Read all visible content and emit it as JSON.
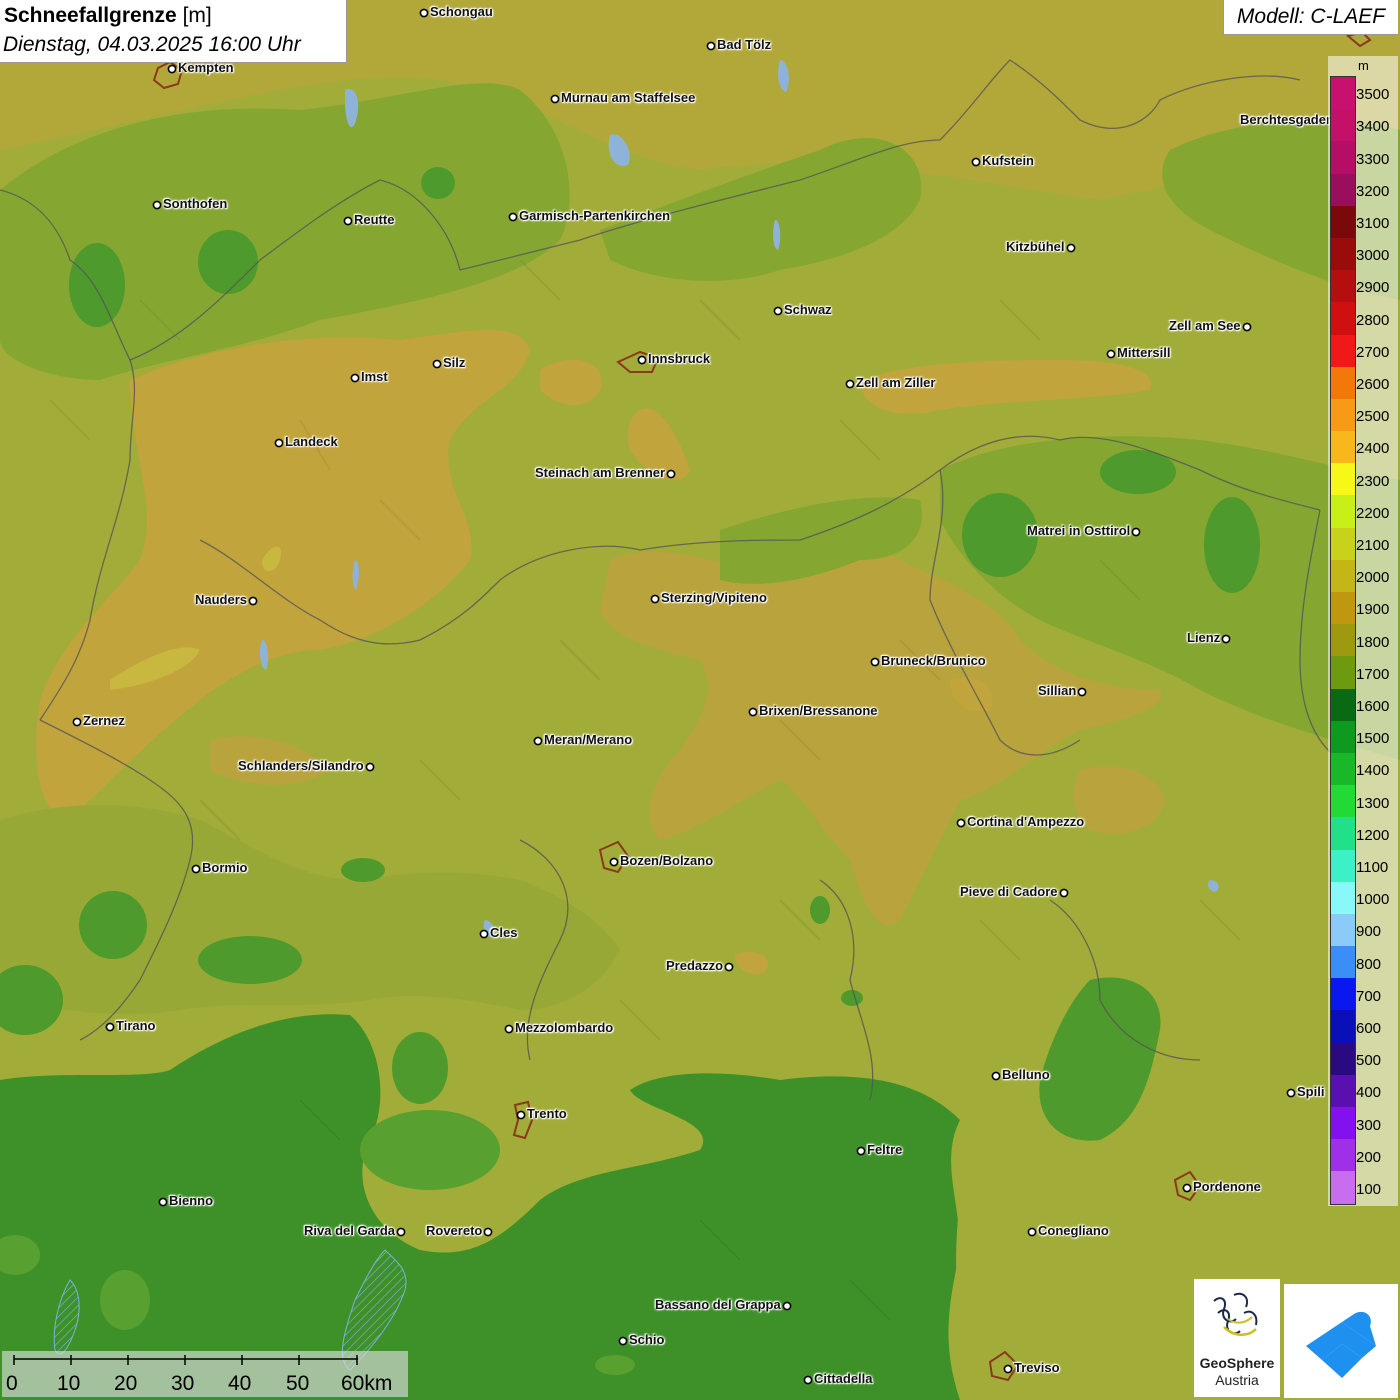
{
  "title": {
    "main": "Schneefallgrenze",
    "unit": "[m]",
    "datetime": "Dienstag, 04.03.2025 16:00 Uhr"
  },
  "model": "Modell: C-LAEF",
  "legend": {
    "unit": "m",
    "levels": [
      {
        "label": "3500",
        "color": "#c8106e"
      },
      {
        "label": "3400",
        "color": "#c5106a"
      },
      {
        "label": "3300",
        "color": "#b50e66"
      },
      {
        "label": "3200",
        "color": "#9a0f5d"
      },
      {
        "label": "3100",
        "color": "#7a0a0a"
      },
      {
        "label": "3000",
        "color": "#9a0b0b"
      },
      {
        "label": "2900",
        "color": "#b50e0e"
      },
      {
        "label": "2800",
        "color": "#d01010"
      },
      {
        "label": "2700",
        "color": "#f01818"
      },
      {
        "label": "2600",
        "color": "#f2780a"
      },
      {
        "label": "2500",
        "color": "#f79a15"
      },
      {
        "label": "2400",
        "color": "#f8b81c"
      },
      {
        "label": "2300",
        "color": "#f8f818"
      },
      {
        "label": "2200",
        "color": "#c8f018"
      },
      {
        "label": "2100",
        "color": "#c8d21a"
      },
      {
        "label": "2000",
        "color": "#c3b616"
      },
      {
        "label": "1900",
        "color": "#c09810"
      },
      {
        "label": "1800",
        "color": "#9e9a10"
      },
      {
        "label": "1700",
        "color": "#6e9a10"
      },
      {
        "label": "1600",
        "color": "#0a6a14"
      },
      {
        "label": "1500",
        "color": "#0e9a1e"
      },
      {
        "label": "1400",
        "color": "#18b828"
      },
      {
        "label": "1300",
        "color": "#22da36"
      },
      {
        "label": "1200",
        "color": "#20e088"
      },
      {
        "label": "1100",
        "color": "#3cf0c8"
      },
      {
        "label": "1000",
        "color": "#88f8f8"
      },
      {
        "label": "900",
        "color": "#8ccaf8"
      },
      {
        "label": "800",
        "color": "#3a8ef6"
      },
      {
        "label": "700",
        "color": "#0a18f0"
      },
      {
        "label": "600",
        "color": "#0a10b8"
      },
      {
        "label": "500",
        "color": "#2a0a80"
      },
      {
        "label": "400",
        "color": "#5a10b0"
      },
      {
        "label": "300",
        "color": "#8410f0"
      },
      {
        "label": "200",
        "color": "#a030e8"
      },
      {
        "label": "100",
        "color": "#c86cf0"
      }
    ]
  },
  "cities": [
    {
      "name": "Schongau"
    },
    {
      "name": "Kempten"
    },
    {
      "name": "Bad Tölz"
    },
    {
      "name": "Murnau am Staffelsee"
    },
    {
      "name": "Berchtesgaden"
    },
    {
      "name": "Kufstein"
    },
    {
      "name": "Sonthofen"
    },
    {
      "name": "Reutte"
    },
    {
      "name": "Garmisch-Partenkirchen"
    },
    {
      "name": "Kitzbühel"
    },
    {
      "name": "Schwaz"
    },
    {
      "name": "Zell am See"
    },
    {
      "name": "Innsbruck"
    },
    {
      "name": "Mittersill"
    },
    {
      "name": "Imst"
    },
    {
      "name": "Silz"
    },
    {
      "name": "Zell am Ziller"
    },
    {
      "name": "Landeck"
    },
    {
      "name": "Steinach am Brenner"
    },
    {
      "name": "Matrei in Osttirol"
    },
    {
      "name": "Nauders"
    },
    {
      "name": "Sterzing/Vipiteno"
    },
    {
      "name": "Lienz"
    },
    {
      "name": "Bruneck/Brunico"
    },
    {
      "name": "Sillian"
    },
    {
      "name": "Zernez"
    },
    {
      "name": "Brixen/Bressanone"
    },
    {
      "name": "Meran/Merano"
    },
    {
      "name": "Schlanders/Silandro"
    },
    {
      "name": "Cortina d'Ampezzo"
    },
    {
      "name": "Bozen/Bolzano"
    },
    {
      "name": "Bormio"
    },
    {
      "name": "Pieve di Cadore"
    },
    {
      "name": "Cles"
    },
    {
      "name": "Predazzo"
    },
    {
      "name": "Tirano"
    },
    {
      "name": "Mezzolombardo"
    },
    {
      "name": "Belluno"
    },
    {
      "name": "Spili"
    },
    {
      "name": "Trento"
    },
    {
      "name": "Feltre"
    },
    {
      "name": "Pordenone"
    },
    {
      "name": "Bienno"
    },
    {
      "name": "Riva del Garda"
    },
    {
      "name": "Rovereto"
    },
    {
      "name": "Conegliano"
    },
    {
      "name": "Bassano del Grappa"
    },
    {
      "name": "Schio"
    },
    {
      "name": "Treviso"
    },
    {
      "name": "Cittadella"
    }
  ],
  "scale": {
    "ticks": [
      "0",
      "10",
      "20",
      "30",
      "40",
      "50",
      "60km"
    ]
  },
  "logos": {
    "geosphere_line1": "GeoSphere",
    "geosphere_line2": "Austria"
  }
}
